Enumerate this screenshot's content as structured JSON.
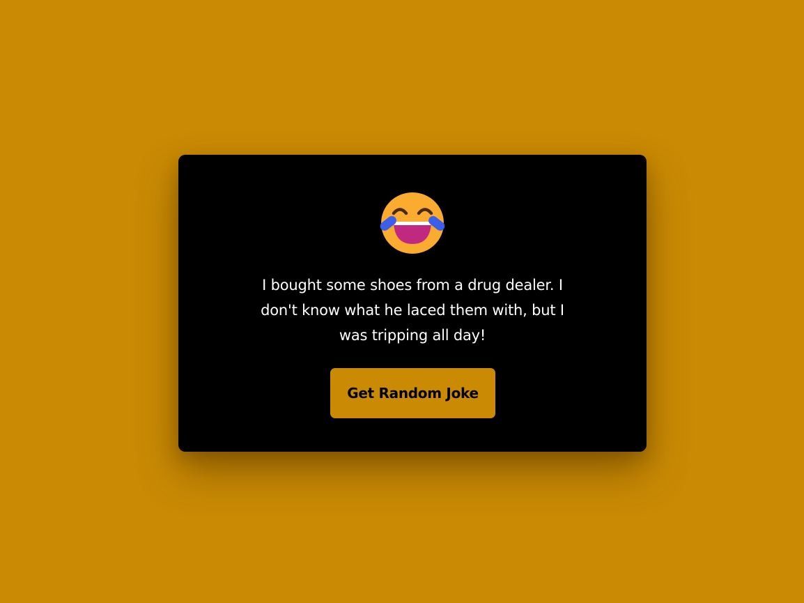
{
  "page": {
    "background_color": "#ca8a04"
  },
  "card": {
    "background_color": "#000000",
    "icon": "laughing-tears-emoji-icon",
    "joke_text": "I bought some shoes from a drug dealer. I don't know what he laced them with, but I was tripping all day!",
    "button_label": "Get Random Joke",
    "button_color": "#ca8a04"
  }
}
